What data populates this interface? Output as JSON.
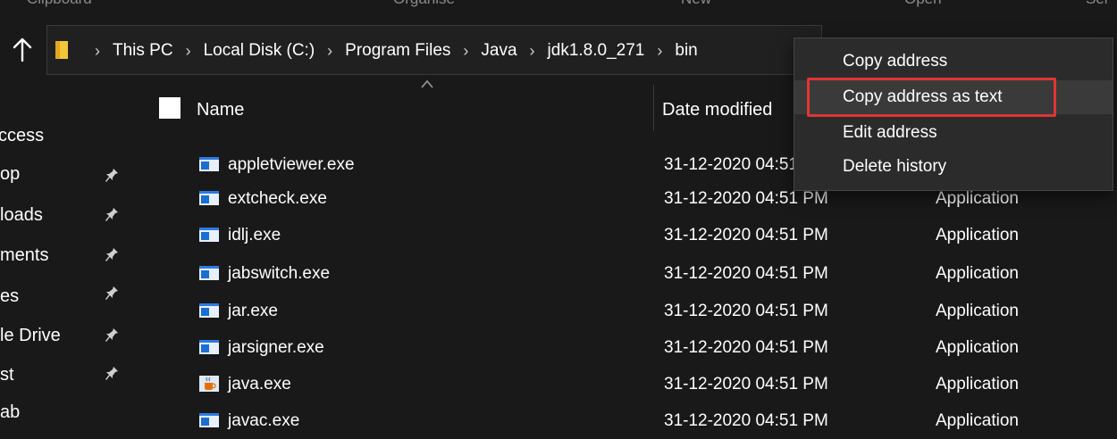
{
  "ribbon": {
    "groups": [
      "Clipboard",
      "Organise",
      "New",
      "Open",
      "Sel"
    ]
  },
  "address_bar": {
    "segments": [
      "This PC",
      "Local Disk (C:)",
      "Program Files",
      "Java",
      "jdk1.8.0_271",
      "bin"
    ],
    "separator": "›"
  },
  "nav_pane": {
    "items": [
      {
        "label": "ccess",
        "pinned": false
      },
      {
        "label": "op",
        "pinned": true
      },
      {
        "label": "loads",
        "pinned": true
      },
      {
        "label": "ments",
        "pinned": true
      },
      {
        "label": "es",
        "pinned": true
      },
      {
        "label": "le Drive",
        "pinned": true
      },
      {
        "label": "st",
        "pinned": true
      },
      {
        "label": "ab",
        "pinned": false
      }
    ]
  },
  "file_list": {
    "columns": {
      "name": "Name",
      "date": "Date modified"
    },
    "rows": [
      {
        "name": "appletviewer.exe",
        "date": "31-12-2020 04:51 PM",
        "type": "",
        "icon": "app-window-icon"
      },
      {
        "name": "extcheck.exe",
        "date": "31-12-2020 04:51 PM",
        "type": "Application",
        "icon": "app-window-icon"
      },
      {
        "name": "idlj.exe",
        "date": "31-12-2020 04:51 PM",
        "type": "Application",
        "icon": "app-window-icon"
      },
      {
        "name": "jabswitch.exe",
        "date": "31-12-2020 04:51 PM",
        "type": "Application",
        "icon": "app-window-icon"
      },
      {
        "name": "jar.exe",
        "date": "31-12-2020 04:51 PM",
        "type": "Application",
        "icon": "app-window-icon"
      },
      {
        "name": "jarsigner.exe",
        "date": "31-12-2020 04:51 PM",
        "type": "Application",
        "icon": "app-window-icon"
      },
      {
        "name": "java.exe",
        "date": "31-12-2020 04:51 PM",
        "type": "Application",
        "icon": "java-coffee-icon"
      },
      {
        "name": "javac.exe",
        "date": "31-12-2020 04:51 PM",
        "type": "Application",
        "icon": "app-window-icon"
      }
    ]
  },
  "context_menu": {
    "items": [
      "Copy address",
      "Copy address as text",
      "Edit address",
      "Delete history"
    ],
    "highlighted_index": 1
  },
  "colors": {
    "background": "#191919",
    "menu_bg": "#2b2b2b",
    "highlight": "#e03535",
    "exe_icon": "#1a6fd1"
  }
}
